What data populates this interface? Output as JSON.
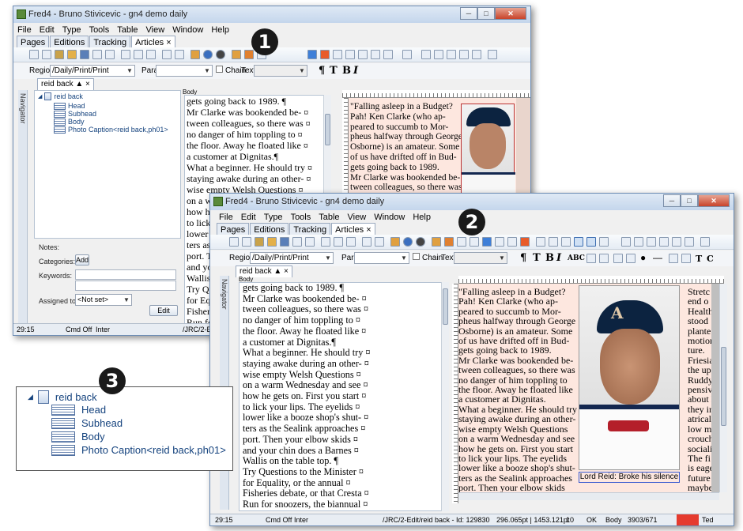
{
  "badges": {
    "one": "1",
    "two": "2",
    "three": "3"
  },
  "window_back": {
    "title": "Fred4 - Bruno Stivicevic - gn4 demo daily",
    "menu": [
      "File",
      "Edit",
      "Type",
      "Tools",
      "Table",
      "View",
      "Window",
      "Help"
    ],
    "tabs": [
      "Pages",
      "Editions",
      "Tracking",
      "Articles ×"
    ],
    "region_label": "Region",
    "region_value": "/Daily/Print/Print",
    "para_label": "Para",
    "chain_label": "Chain",
    "text_label": "Text",
    "doc_tab": "reid back ▲ ×",
    "navigator_label": "Navigator",
    "pane_label": "Body",
    "tree": {
      "root": "reid back",
      "items": [
        "Head",
        "Subhead",
        "Body",
        "Photo Caption<reid back,ph01>"
      ]
    },
    "form": {
      "notes": "Notes:",
      "categories": "Categories:",
      "add": "Add",
      "keywords": "Keywords:",
      "assigned": "Assigned to:",
      "assigned_value": "<Not set>",
      "edit": "Edit"
    },
    "text_lines": [
      "gets going back to 1989. ¶",
      "Mr Clarke was bookended be- ¤",
      "tween colleagues, so there was ¤",
      "no danger of him toppling to ¤",
      "the floor. Away he floated like ¤",
      "a customer at Dignitas.¶",
      "What a beginner. He should try ¤",
      "staying awake during an other- ¤",
      "wise empty Welsh Questions ¤",
      "on a warm Wednesday and see ¤",
      "how he gets on. First you start ¤",
      "to lick",
      "lower l",
      "ters as",
      "port. T",
      "and yo",
      "Wallis",
      "Try Qu",
      "for Equ",
      "Fisheri",
      "Run fo",
      "Liaison",
      "with th"
    ],
    "layout_lines": [
      "\"Falling asleep in a Budget?",
      "Pah! Ken Clarke (who ap-",
      "peared to succumb to Mor-",
      "pheus halfway through George",
      "Osborne) is an amateur. Some",
      "of us have drifted off in Bud-",
      "gets going back to 1989.",
      "Mr Clarke was bookended be-",
      "tween colleagues, so there was",
      "no danger of him toppling to"
    ],
    "status": {
      "pos": "29:15",
      "cmd": "Cmd Off",
      "mode": "Inter",
      "path": "/JRC/2-Edit/reid back"
    }
  },
  "window_front": {
    "title": "Fred4 - Bruno Stivicevic - gn4 demo daily",
    "menu": [
      "File",
      "Edit",
      "Type",
      "Tools",
      "Table",
      "View",
      "Window",
      "Help"
    ],
    "tabs": [
      "Pages",
      "Editions",
      "Tracking",
      "Articles ×"
    ],
    "region_label": "Region",
    "region_value": "/Daily/Print/Print",
    "para_label": "Para",
    "chain_label": "Chain",
    "text_label": "Text",
    "doc_tab": "reid back ▲ ×",
    "navigator_label": "Navigator",
    "pane_label": "Body",
    "text_lines": [
      "gets going back to 1989. ¶",
      "Mr Clarke was bookended be- ¤",
      "tween colleagues, so there was ¤",
      "no danger of him toppling to ¤",
      "the floor. Away he floated like ¤",
      "a customer at Dignitas.¶",
      "What a beginner. He should try ¤",
      "staying awake during an other- ¤",
      "wise empty Welsh Questions ¤",
      "on a warm Wednesday and see ¤",
      "how he gets on. First you start ¤",
      "to lick your lips. The eyelids ¤",
      "lower like a booze shop's shut- ¤",
      "ters as the Sealink approaches ¤",
      "port. Then your elbow skids ¤",
      "and your chin does a Barnes ¤",
      "Wallis on the table top. ¶",
      "Try Questions to the Minister ¤",
      "for Equality, or the annual ¤",
      "Fisheries debate, or that Cresta ¤",
      "Run for snoozers, the biannual ¤",
      "Liaison Committee meeting ¤",
      "with the Prime Minister. Lines ¤"
    ],
    "layout_lines": [
      "\"Falling asleep in a Budget?",
      "Pah! Ken Clarke (who ap-",
      "peared to succumb to Mor-",
      "pheus halfway through George",
      "Osborne) is an amateur. Some",
      "of us have drifted off in Bud-",
      "gets going back to 1989.",
      "Mr Clarke was bookended be-",
      "tween colleagues, so there was",
      "no danger of him toppling to",
      "the floor. Away he floated like",
      "a customer at Dignitas.",
      "What a beginner. He should try",
      "staying awake during an other-",
      "wise empty Welsh Questions",
      "on a warm Wednesday and see",
      "how he gets on. First you start",
      "to lick your lips. The eyelids",
      "lower like a booze shop's shut-",
      "ters as the Sealink approaches",
      "port. Then your elbow skids",
      "and your chin does a Barnes"
    ],
    "right_col_lines": [
      "Stretc",
      "end o",
      "Health",
      "stood",
      "plante",
      "motion",
      "ture.",
      "Friesia",
      "the up",
      "Ruddy",
      "pensiv",
      "about l",
      "they in",
      "atrical",
      "low me",
      "crouch",
      "socialis",
      "The fi",
      "is eage",
      "future",
      "maybe"
    ],
    "caption": "Lord Reid: Broke his silence",
    "status": {
      "pos": "29:15",
      "cmd": "Cmd Off",
      "mode": "Inter",
      "path": "/JRC/2-Edit/reid back - Id: 129830",
      "coords": "296.065pt | 1453.121pt",
      "num": "10",
      "ok": "OK",
      "style": "Body",
      "count": "3903/671",
      "user": "Ted"
    }
  },
  "tree_zoom": {
    "root": "reid back",
    "items": [
      "Head",
      "Subhead",
      "Body",
      "Photo Caption<reid back,ph01>"
    ]
  }
}
